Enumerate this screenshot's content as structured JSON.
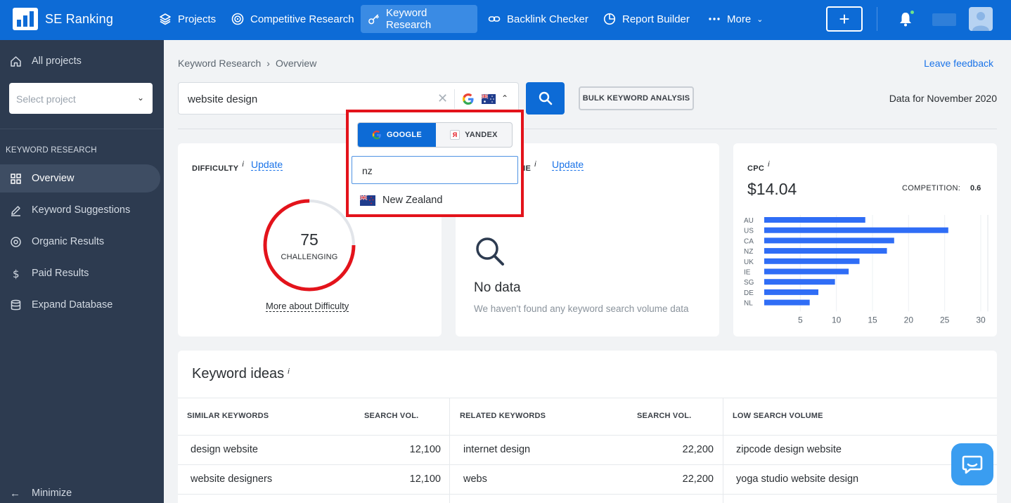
{
  "header": {
    "brand": "SE Ranking",
    "nav": [
      {
        "label": "Projects",
        "icon": "layers-icon"
      },
      {
        "label": "Competitive Research",
        "icon": "target-icon"
      },
      {
        "label": "Keyword Research",
        "icon": "key-icon",
        "active": true
      },
      {
        "label": "Backlink Checker",
        "icon": "link-icon"
      },
      {
        "label": "Report Builder",
        "icon": "pie-chart-icon"
      },
      {
        "label": "More",
        "icon": "more-dots-icon"
      }
    ],
    "add_label": "+"
  },
  "sidebar": {
    "all_projects": "All projects",
    "select_placeholder": "Select project",
    "section_title": "KEYWORD RESEARCH",
    "items": [
      {
        "label": "Overview",
        "icon": "grid-icon",
        "active": true
      },
      {
        "label": "Keyword Suggestions",
        "icon": "pencil-icon"
      },
      {
        "label": "Organic Results",
        "icon": "target-icon"
      },
      {
        "label": "Paid Results",
        "icon": "dollar-icon"
      },
      {
        "label": "Expand Database",
        "icon": "database-icon"
      }
    ],
    "minimize": "Minimize"
  },
  "breadcrumb": [
    "Keyword Research",
    "Overview"
  ],
  "leave_feedback": "Leave feedback",
  "search": {
    "value": "website design",
    "engine": "google",
    "country": "AU"
  },
  "bulk_button": "BULK KEYWORD ANALYSIS",
  "data_for": "Data for November 2020",
  "difficulty": {
    "label": "DIFFICULTY",
    "info": "i",
    "update": "Update",
    "value": 75,
    "level": "CHALLENGING",
    "more": "More about Difficulty"
  },
  "volume": {
    "label_visible": "ME",
    "info": "i",
    "update": "Update",
    "no_data_title": "No data",
    "no_data_sub": "We haven't found any keyword search volume data"
  },
  "cpc": {
    "label": "CPC",
    "info": "i",
    "value": "$14.04",
    "competition_label": "COMPETITION:",
    "competition_value": "0.6"
  },
  "chart_data": {
    "type": "bar",
    "orientation": "horizontal",
    "categories": [
      "AU",
      "US",
      "CA",
      "NZ",
      "UK",
      "IE",
      "SG",
      "DE",
      "NL"
    ],
    "values": [
      14,
      25.5,
      18,
      17,
      13.2,
      11.7,
      9.8,
      7.5,
      6.3
    ],
    "xticks": [
      5,
      10,
      15,
      20,
      25,
      30
    ],
    "xlim": [
      0,
      30
    ],
    "color": "#2f6df6"
  },
  "keyword_ideas": {
    "title": "Keyword ideas",
    "info": "i",
    "columns": [
      {
        "header": "SIMILAR KEYWORDS",
        "vol_header": "SEARCH VOL.",
        "rows": [
          [
            "design website",
            "12,100"
          ],
          [
            "website designers",
            "12,100"
          ]
        ]
      },
      {
        "header": "RELATED KEYWORDS",
        "vol_header": "SEARCH VOL.",
        "rows": [
          [
            "internet design",
            "22,200"
          ],
          [
            "webs",
            "22,200"
          ]
        ]
      },
      {
        "header": "LOW SEARCH VOLUME",
        "rows": [
          [
            "zipcode design website"
          ],
          [
            "yoga studio website design"
          ]
        ]
      }
    ]
  },
  "popup": {
    "tabs": [
      {
        "label": "GOOGLE",
        "active": true
      },
      {
        "label": "YANDEX"
      }
    ],
    "yandex_glyph": "Я",
    "query": "nz",
    "option": "New Zealand"
  }
}
